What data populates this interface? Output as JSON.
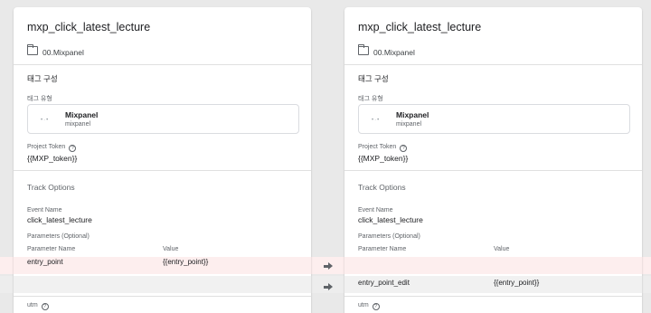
{
  "left": {
    "title": "mxp_click_latest_lecture",
    "folder": "00.Mixpanel",
    "config_heading": "태그 구성",
    "tag_type_label": "태그 유형",
    "tag_name": "Mixpanel",
    "tag_subtitle": "mixpanel",
    "project_token_label": "Project Token",
    "project_token_value": "{{MXP_token}}",
    "track_options_heading": "Track Options",
    "event_name_label": "Event Name",
    "event_name_value": "click_latest_lecture",
    "params_label": "Parameters (Optional)",
    "param_name_header": "Parameter Name",
    "param_value_header": "Value",
    "param_row": {
      "name": "entry_point",
      "value": "{{entry_point}}"
    },
    "utm_label": "utm"
  },
  "right": {
    "title": "mxp_click_latest_lecture",
    "folder": "00.Mixpanel",
    "config_heading": "태그 구성",
    "tag_type_label": "태그 유형",
    "tag_name": "Mixpanel",
    "tag_subtitle": "mixpanel",
    "project_token_label": "Project Token",
    "project_token_value": "{{MXP_token}}",
    "track_options_heading": "Track Options",
    "event_name_label": "Event Name",
    "event_name_value": "click_latest_lecture",
    "params_label": "Parameters (Optional)",
    "param_name_header": "Parameter Name",
    "param_value_header": "Value",
    "param_row": {
      "name": "entry_point_edit",
      "value": "{{entry_point}}"
    },
    "utm_label": "utm"
  },
  "icons": {
    "folder": "folder-icon",
    "help": "help-circle-icon",
    "tag_type": "mixpanel-dots-icon",
    "diff_arrow": "arrow-right-icon"
  },
  "colors": {
    "removed_row": "#fdeeee",
    "added_row": "#ededed",
    "background": "#e9e9e9"
  }
}
